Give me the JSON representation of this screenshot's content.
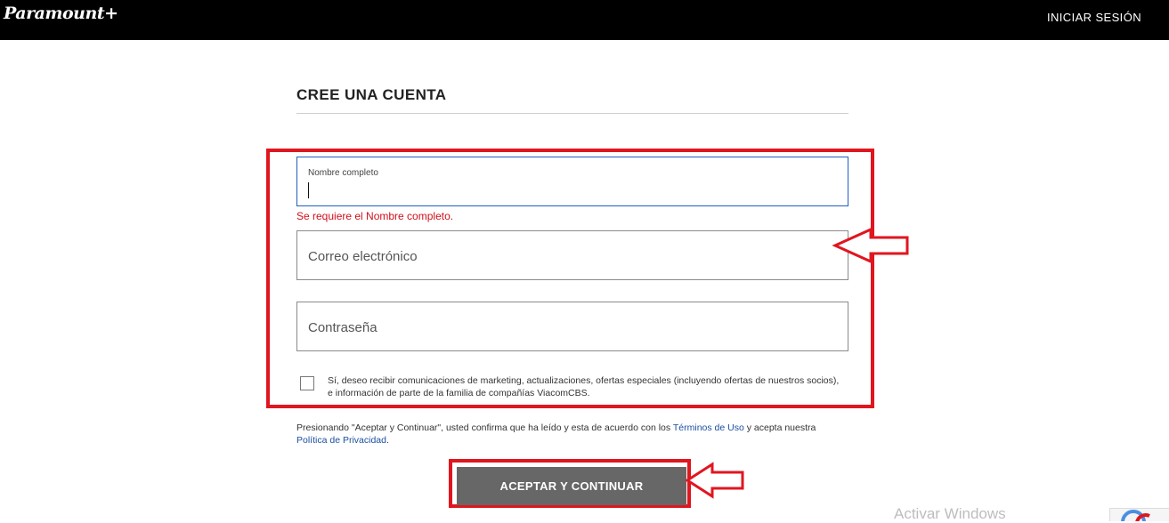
{
  "header": {
    "logo_text": "Paramount+",
    "signin_label": "INICIAR SESIÓN"
  },
  "form": {
    "title": "CREE UNA CUENTA",
    "name_field": {
      "label": "Nombre completo",
      "value": "",
      "error": "Se requiere el Nombre completo."
    },
    "email_field": {
      "placeholder": "Correo electrónico",
      "value": ""
    },
    "password_field": {
      "placeholder": "Contraseña",
      "value": ""
    },
    "marketing_checkbox": {
      "checked": false,
      "label": "Sí, deseo recibir comunicaciones de marketing, actualizaciones, ofertas especiales (incluyendo ofertas de nuestros socios), e información de parte de la familia de compañías ViacomCBS."
    },
    "legal": {
      "before_terms": "Presionando \"Aceptar y Continuar\", usted confirma que ha leído y esta de acuerdo con los ",
      "terms_link": "Términos de Uso",
      "between": " y acepta nuestra ",
      "privacy_link": "Política de Privacidad",
      "after": "."
    },
    "submit_label": "ACEPTAR Y CONTINUAR"
  },
  "annotations": {
    "highlight_color": "#e0161f"
  },
  "os": {
    "watermark": "Activar Windows"
  },
  "colors": {
    "header_bg": "#000000",
    "error": "#d0101a",
    "link": "#1b4fa0",
    "button_bg": "#676767"
  }
}
